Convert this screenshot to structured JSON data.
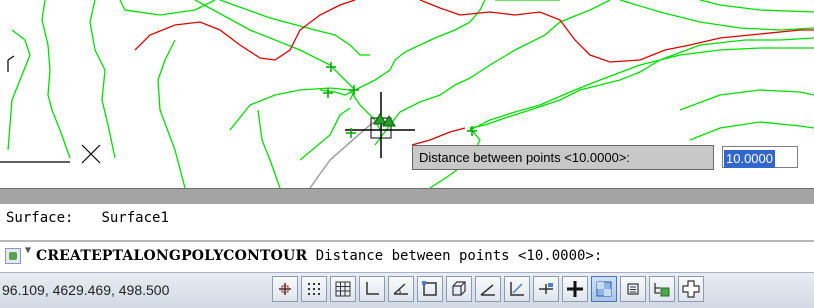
{
  "drawing": {
    "tooltip_prompt": "Distance between points <10.0000>:",
    "input_value": "10.0000"
  },
  "command_history": {
    "label": "Surface:",
    "value": "Surface1"
  },
  "command_line": {
    "command_name": "CREATEPTALONGPOLYCONTOUR",
    "prompt": " Distance between points <10.0000>:"
  },
  "status_bar": {
    "coordinates": "96.109, 4629.469, 498.500",
    "buttons": [
      {
        "name": "infer-constraints",
        "active": false
      },
      {
        "name": "snap-mode",
        "active": false
      },
      {
        "name": "grid-display",
        "active": false
      },
      {
        "name": "ortho-mode",
        "active": false
      },
      {
        "name": "polar-tracking",
        "active": false
      },
      {
        "name": "object-snap",
        "active": false
      },
      {
        "name": "3d-object-snap",
        "active": false
      },
      {
        "name": "object-snap-tracking",
        "active": false
      },
      {
        "name": "dynamic-ucs",
        "active": false
      },
      {
        "name": "dynamic-input",
        "active": false
      },
      {
        "name": "lineweight",
        "active": false
      },
      {
        "name": "transparency",
        "active": true
      },
      {
        "name": "quick-properties",
        "active": false
      },
      {
        "name": "selection-cycling",
        "active": false
      },
      {
        "name": "annotation-monitor",
        "active": false
      }
    ]
  },
  "colors": {
    "contour_minor": "#00e000",
    "contour_major": "#e00000",
    "selection_highlight": "#3366cc"
  }
}
